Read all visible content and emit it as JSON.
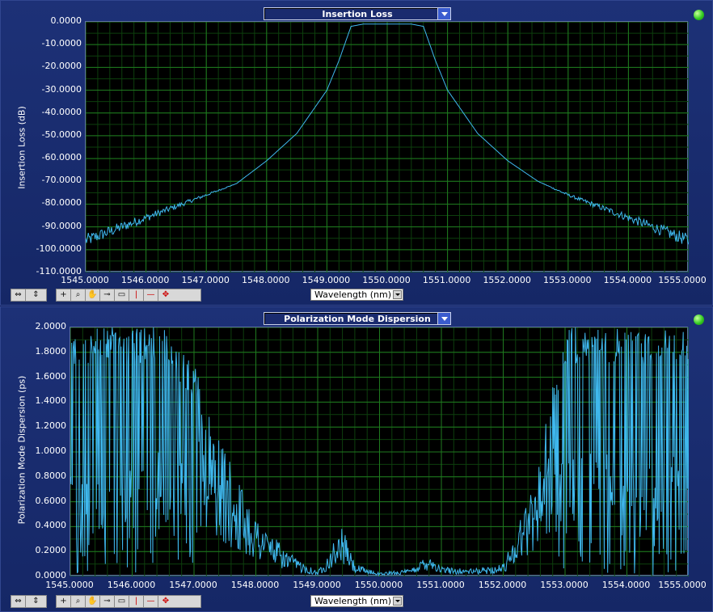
{
  "graphs": [
    {
      "title": "Insertion Loss",
      "ylabel": "Insertion Loss (dB)",
      "xlabel": "Wavelength (nm)",
      "yticks": [
        "0.0000",
        "-10.0000",
        "-20.0000",
        "-30.0000",
        "-40.0000",
        "-50.0000",
        "-60.0000",
        "-70.0000",
        "-80.0000",
        "-90.0000",
        "-100.0000",
        "-110.0000"
      ],
      "xticks": [
        "1545.0000",
        "1546.0000",
        "1547.0000",
        "1548.0000",
        "1549.0000",
        "1550.0000",
        "1551.0000",
        "1552.0000",
        "1553.0000",
        "1554.0000",
        "1555.0000"
      ],
      "icons": [
        "zoom-x-icon",
        "zoom-y-icon"
      ],
      "tools": [
        "crosshair-tool-icon",
        "zoom-tool-icon",
        "hand-tool-icon",
        "key-tool-icon",
        "rect-tool-icon",
        "vcursor-tool-icon",
        "hcursor-tool-icon",
        "move-cursor-tool-icon"
      ]
    },
    {
      "title": "Polarization Mode Dispersion",
      "ylabel": "Polarization Mode Dispersion (ps)",
      "xlabel": "Wavelength (nm)",
      "yticks": [
        "2.0000",
        "1.8000",
        "1.6000",
        "1.4000",
        "1.2000",
        "1.0000",
        "0.8000",
        "0.6000",
        "0.4000",
        "0.2000",
        "0.0000"
      ],
      "xticks": [
        "1545.0000",
        "1546.0000",
        "1547.0000",
        "1548.0000",
        "1549.0000",
        "1550.0000",
        "1551.0000",
        "1552.0000",
        "1553.0000",
        "1554.0000",
        "1555.0000"
      ],
      "icons": [
        "zoom-x-icon",
        "zoom-y-icon"
      ],
      "tools": [
        "crosshair-tool-icon",
        "zoom-tool-icon",
        "hand-tool-icon",
        "key-tool-icon",
        "rect-tool-icon",
        "vcursor-tool-icon",
        "hcursor-tool-icon",
        "move-cursor-tool-icon"
      ]
    }
  ],
  "colors": {
    "trace": "#3fb8ee",
    "grid": "#1f7a1f",
    "plot_bg": "#000000",
    "panel_bg": "#1b2e73"
  },
  "chart_data": [
    {
      "type": "line",
      "title": "Insertion Loss",
      "xlabel": "Wavelength (nm)",
      "ylabel": "Insertion Loss (dB)",
      "xlim": [
        1545,
        1555
      ],
      "ylim": [
        -110,
        0
      ],
      "grid": true,
      "series": [
        {
          "x": [
            1545.0,
            1545.5,
            1546.0,
            1546.5,
            1547.0,
            1547.5,
            1548.0,
            1548.5,
            1549.0,
            1549.2,
            1549.4,
            1549.6,
            1549.8,
            1550.0,
            1550.2,
            1550.4,
            1550.6,
            1550.8,
            1551.0,
            1551.5,
            1552.0,
            1552.5,
            1553.0,
            1553.5,
            1554.0,
            1554.5,
            1555.0
          ],
          "values": [
            -96,
            -91,
            -86,
            -81,
            -76,
            -71,
            -61,
            -49,
            -30,
            -17,
            -2,
            -1,
            -1,
            -1,
            -1,
            -1,
            -2,
            -17,
            -30,
            -49,
            -61,
            -70,
            -76,
            -81,
            -86,
            -91,
            -96
          ]
        }
      ]
    },
    {
      "type": "line",
      "title": "Polarization Mode Dispersion",
      "xlabel": "Wavelength (nm)",
      "ylabel": "Polarization Mode Dispersion (ps)",
      "xlim": [
        1545,
        1555
      ],
      "ylim": [
        0,
        2
      ],
      "grid": true,
      "series": [
        {
          "x": [
            1545.0,
            1545.5,
            1546.0,
            1546.5,
            1547.0,
            1547.5,
            1548.0,
            1548.5,
            1549.0,
            1549.4,
            1549.6,
            1550.0,
            1550.5,
            1550.8,
            1551.0,
            1551.5,
            1552.0,
            1552.5,
            1553.0,
            1553.5,
            1554.0,
            1554.5,
            1555.0
          ],
          "envelope": [
            2.0,
            2.0,
            2.0,
            2.0,
            1.7,
            1.0,
            0.5,
            0.2,
            0.04,
            0.4,
            0.1,
            0.03,
            0.06,
            0.2,
            0.08,
            0.06,
            0.1,
            0.8,
            2.0,
            2.0,
            2.0,
            2.0,
            2.0
          ]
        }
      ]
    }
  ]
}
